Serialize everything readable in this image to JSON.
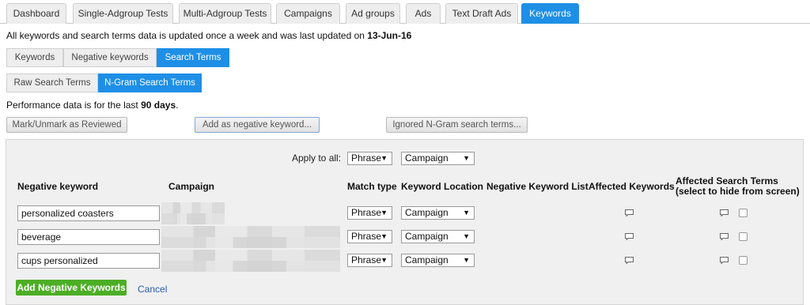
{
  "tabs": [
    {
      "label": "Dashboard",
      "active": false
    },
    {
      "label": "Single-Adgroup Tests",
      "active": false
    },
    {
      "label": "Multi-Adgroup Tests",
      "active": false
    },
    {
      "label": "Campaigns",
      "active": false
    },
    {
      "label": "Ad groups",
      "active": false
    },
    {
      "label": "Ads",
      "active": false
    },
    {
      "label": "Text Draft Ads",
      "active": false
    },
    {
      "label": "Keywords",
      "active": true
    }
  ],
  "update_note": {
    "prefix": "All keywords and search terms data is updated once a week and was last updated on ",
    "date": "13-Jun-16"
  },
  "subtabs": [
    {
      "label": "Keywords",
      "active": false
    },
    {
      "label": "Negative keywords",
      "active": false
    },
    {
      "label": "Search Terms",
      "active": true
    }
  ],
  "search_term_tabs": [
    {
      "label": "Raw Search Terms",
      "active": false
    },
    {
      "label": "N-Gram Search Terms",
      "active": true
    }
  ],
  "performance_note": {
    "prefix": "Performance data is for the last ",
    "period": "90 days",
    "suffix": "."
  },
  "actions": {
    "mark_reviewed": "Mark/Unmark as Reviewed",
    "add_negative": "Add as negative keyword...",
    "ignored": "Ignored N-Gram search terms..."
  },
  "panel": {
    "apply_all_label": "Apply to all:",
    "apply_match": "Phrase",
    "apply_location": "Campaign",
    "headers": {
      "negative_keyword": "Negative keyword",
      "campaign": "Campaign",
      "match_type": "Match type",
      "keyword_location": "Keyword Location",
      "negative_keyword_list": "Negative Keyword List",
      "affected_keywords": "Affected Keywords",
      "affected_search_terms": "Affected Search Terms",
      "affected_search_terms_sub": "(select to hide from screen)"
    },
    "rows": [
      {
        "keyword": "personalized coasters",
        "match": "Phrase",
        "location": "Campaign",
        "hidden": false
      },
      {
        "keyword": "beverage",
        "match": "Phrase",
        "location": "Campaign",
        "hidden": false
      },
      {
        "keyword": "cups personalized",
        "match": "Phrase",
        "location": "Campaign",
        "hidden": false
      }
    ],
    "submit_label": "Add Negative Keywords",
    "cancel_label": "Cancel"
  },
  "colors": {
    "accent": "#1e8fe6",
    "success": "#4cae25",
    "link": "#2a5db0"
  }
}
